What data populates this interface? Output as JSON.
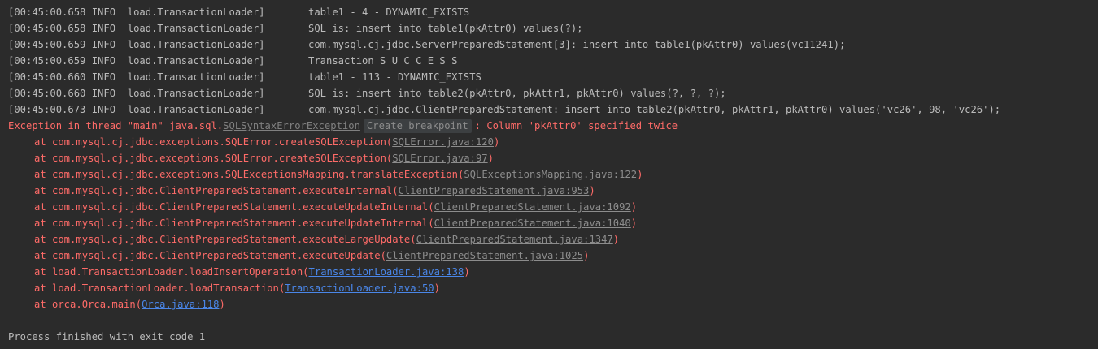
{
  "log": [
    {
      "prefix": "[00:45:00.658 INFO  load.TransactionLoader]",
      "message": "table1 - 4 - DYNAMIC_EXISTS"
    },
    {
      "prefix": "[00:45:00.658 INFO  load.TransactionLoader]",
      "message": "SQL is: insert into table1(pkAttr0) values(?);"
    },
    {
      "prefix": "[00:45:00.659 INFO  load.TransactionLoader]",
      "message": "com.mysql.cj.jdbc.ServerPreparedStatement[3]: insert into table1(pkAttr0) values(vc11241);"
    },
    {
      "prefix": "[00:45:00.659 INFO  load.TransactionLoader]",
      "message": "Transaction S U C C E S S"
    },
    {
      "prefix": "[00:45:00.660 INFO  load.TransactionLoader]",
      "message": "table1 - 113 - DYNAMIC_EXISTS"
    },
    {
      "prefix": "[00:45:00.660 INFO  load.TransactionLoader]",
      "message": "SQL is: insert into table2(pkAttr0, pkAttr1, pkAttr0) values(?, ?, ?);"
    },
    {
      "prefix": "[00:45:00.673 INFO  load.TransactionLoader]",
      "message": "com.mysql.cj.jdbc.ClientPreparedStatement: insert into table2(pkAttr0, pkAttr1, pkAttr0) values('vc26', 98, 'vc26');"
    }
  ],
  "exception": {
    "prefix": "Exception in thread \"main\" java.sql.",
    "class_link": "SQLSyntaxErrorException",
    "breakpoint_label": "Create breakpoint",
    "message": ": Column 'pkAttr0' specified twice"
  },
  "stack": [
    {
      "at": "at com.mysql.cj.jdbc.exceptions.SQLError.createSQLException(",
      "link": "SQLError.java:120",
      "kind": "lib",
      "close": ")"
    },
    {
      "at": "at com.mysql.cj.jdbc.exceptions.SQLError.createSQLException(",
      "link": "SQLError.java:97",
      "kind": "lib",
      "close": ")"
    },
    {
      "at": "at com.mysql.cj.jdbc.exceptions.SQLExceptionsMapping.translateException(",
      "link": "SQLExceptionsMapping.java:122",
      "kind": "lib",
      "close": ")"
    },
    {
      "at": "at com.mysql.cj.jdbc.ClientPreparedStatement.executeInternal(",
      "link": "ClientPreparedStatement.java:953",
      "kind": "lib",
      "close": ")"
    },
    {
      "at": "at com.mysql.cj.jdbc.ClientPreparedStatement.executeUpdateInternal(",
      "link": "ClientPreparedStatement.java:1092",
      "kind": "lib",
      "close": ")"
    },
    {
      "at": "at com.mysql.cj.jdbc.ClientPreparedStatement.executeUpdateInternal(",
      "link": "ClientPreparedStatement.java:1040",
      "kind": "lib",
      "close": ")"
    },
    {
      "at": "at com.mysql.cj.jdbc.ClientPreparedStatement.executeLargeUpdate(",
      "link": "ClientPreparedStatement.java:1347",
      "kind": "lib",
      "close": ")"
    },
    {
      "at": "at com.mysql.cj.jdbc.ClientPreparedStatement.executeUpdate(",
      "link": "ClientPreparedStatement.java:1025",
      "kind": "lib",
      "close": ")"
    },
    {
      "at": "at load.TransactionLoader.loadInsertOperation(",
      "link": "TransactionLoader.java:138",
      "kind": "src",
      "close": ")"
    },
    {
      "at": "at load.TransactionLoader.loadTransaction(",
      "link": "TransactionLoader.java:50",
      "kind": "src",
      "close": ")"
    },
    {
      "at": "at orca.Orca.main(",
      "link": "Orca.java:118",
      "kind": "src",
      "close": ")"
    }
  ],
  "exit_message": "Process finished with exit code 1",
  "colors": {
    "background": "#2b2b2b",
    "log_text": "#bbbbbb",
    "error_text": "#ff6b68",
    "library_link": "#8c8c8c",
    "source_link": "#4a86e8"
  }
}
